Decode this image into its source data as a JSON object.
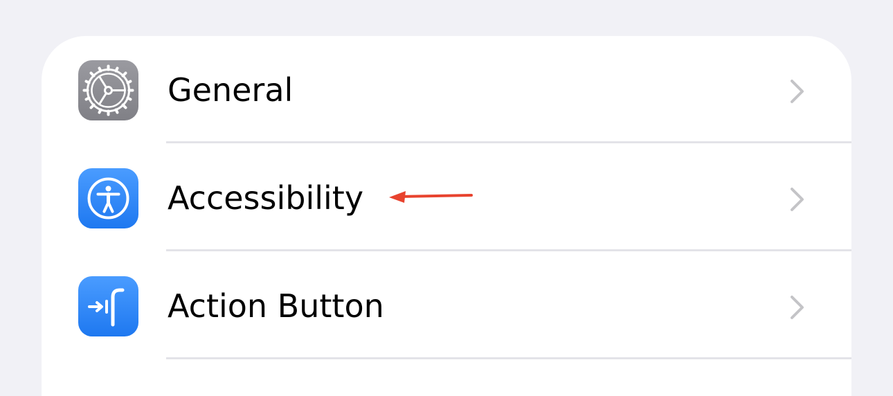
{
  "settings": {
    "items": [
      {
        "label": "General",
        "icon": "gear-icon",
        "icon_bg": "#8e8e93"
      },
      {
        "label": "Accessibility",
        "icon": "accessibility-icon",
        "icon_bg": "#2f86f6"
      },
      {
        "label": "Action Button",
        "icon": "action-button-icon",
        "icon_bg": "#2f86f6"
      }
    ]
  },
  "colors": {
    "background": "#f1f1f6",
    "card": "#ffffff",
    "chevron": "#c4c4c7",
    "separator": "#e3e3e8",
    "annotation_arrow": "#e8432e"
  }
}
